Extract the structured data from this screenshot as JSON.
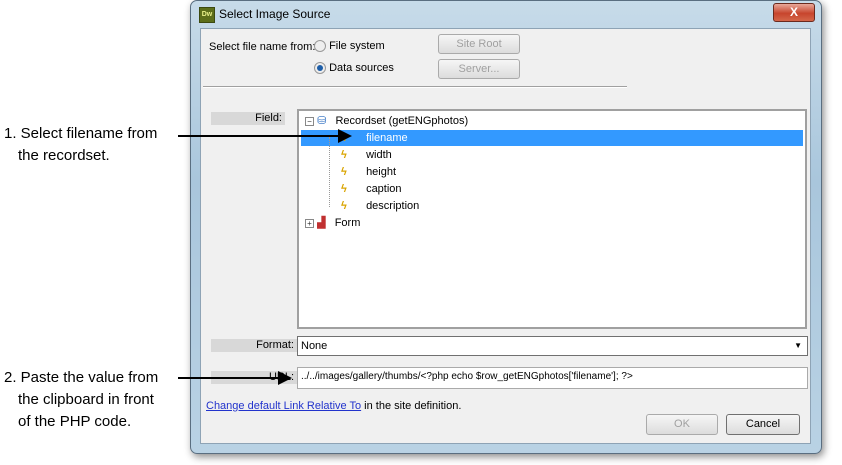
{
  "dialog": {
    "title": "Select Image Source",
    "app_icon": "Dw",
    "close": "X"
  },
  "source": {
    "label": "Select file name from:",
    "options": [
      "File system",
      "Data sources"
    ],
    "selected": "Data sources",
    "site_root": "Site Root",
    "server": "Server..."
  },
  "field": {
    "label": "Field:",
    "tree": {
      "recordset": "Recordset (getENGphotos)",
      "fields": [
        "filename",
        "width",
        "height",
        "caption",
        "description"
      ],
      "selected": "filename",
      "form": "Form"
    }
  },
  "format": {
    "label": "Format:",
    "value": "None"
  },
  "url": {
    "label": "URL:",
    "value": "../../images/gallery/thumbs/<?php echo $row_getENGphotos['filename']; ?>"
  },
  "link": {
    "text": "Change default Link Relative To",
    "suffix": " in the site definition."
  },
  "buttons": {
    "ok": "OK",
    "cancel": "Cancel"
  },
  "annotations": {
    "one": [
      "1. Select filename from",
      "the recordset."
    ],
    "two": [
      "2. Paste the value from",
      "the clipboard in front",
      "of the PHP code."
    ]
  }
}
